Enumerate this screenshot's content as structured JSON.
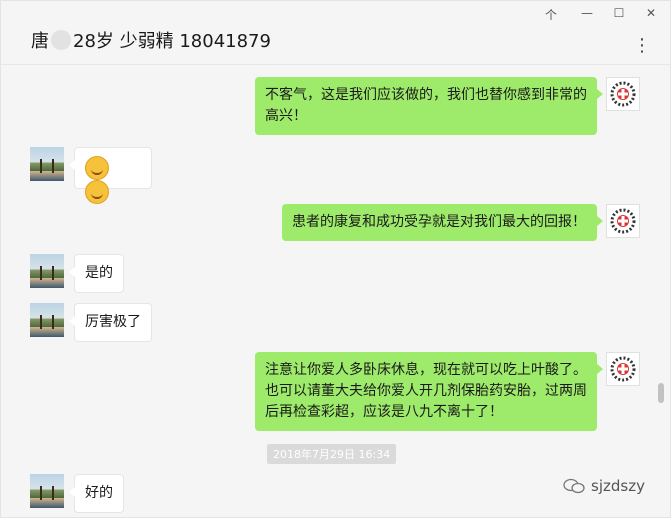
{
  "header": {
    "name_prefix": "唐",
    "name_suffix": "28岁 少弱精 18041879",
    "menu_glyph": "⋮",
    "controls": [
      "个",
      "—",
      "☐",
      "✕"
    ]
  },
  "messages": [
    {
      "side": "me",
      "text": "不客气，这是我们应该做的，我们也替你感到非常的高兴！"
    },
    {
      "side": "other",
      "type": "emoji",
      "count": 2
    },
    {
      "side": "me",
      "text": "患者的康复和成功受孕就是对我们最大的回报！"
    },
    {
      "side": "other",
      "text": "是的"
    },
    {
      "side": "other",
      "text": "厉害极了"
    },
    {
      "side": "me",
      "text": "注意让你爱人多卧床休息，现在就可以吃上叶酸了。也可以请董大夫给你爱人开几剂保胎药安胎，过两周后再检查彩超，应该是八九不离十了！"
    },
    {
      "side": "other",
      "text": "好的"
    }
  ],
  "timestamp": "2018年7月29日 16:34",
  "watermark": "sjzdszy",
  "colors": {
    "my_bubble": "#9eea6a",
    "other_bubble": "#ffffff",
    "background": "#f5f5f5"
  }
}
